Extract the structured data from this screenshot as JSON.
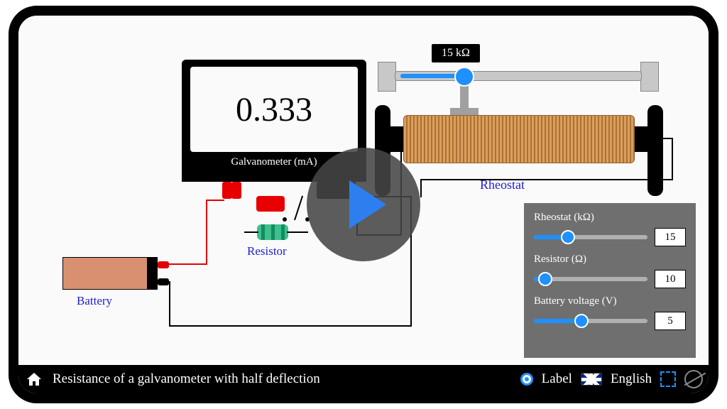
{
  "galvanometer": {
    "reading": "0.333",
    "label": "Galvanometer (mA)"
  },
  "rheostat": {
    "display": "15 kΩ",
    "label": "Rheostat"
  },
  "resistor": {
    "label": "Resistor"
  },
  "battery": {
    "label": "Battery"
  },
  "panel": {
    "rheostat": {
      "label": "Rheostat (kΩ)",
      "value": "15",
      "min": 0,
      "max": 50,
      "percent": 30
    },
    "resistor": {
      "label": "Resistor (Ω)",
      "value": "10",
      "min": 0,
      "max": 100,
      "percent": 10
    },
    "battery": {
      "label": "Battery voltage (V)",
      "value": "5",
      "min": 0,
      "max": 12,
      "percent": 42
    }
  },
  "bottombar": {
    "title": "Resistance of a galvanometer with half deflection",
    "label_toggle": "Label",
    "language": "English"
  },
  "colors": {
    "accent": "#1e90ff",
    "link": "#2020d0",
    "danger": "#e80000"
  }
}
